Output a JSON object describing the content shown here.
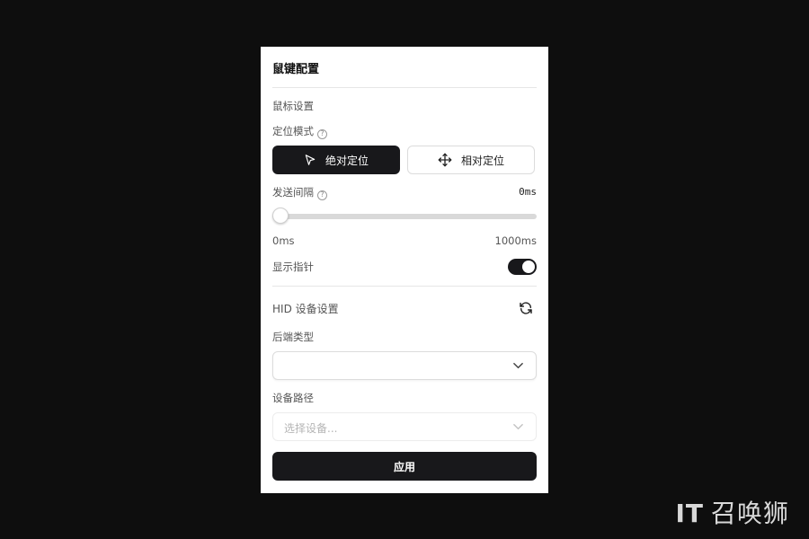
{
  "panel": {
    "title": "鼠键配置",
    "mouse_section": "鼠标设置",
    "position_mode": {
      "label": "定位模式",
      "absolute_label": "绝对定位",
      "relative_label": "相对定位",
      "selected": "absolute"
    },
    "send_interval": {
      "label": "发送间隔",
      "value": "0ms",
      "min_label": "0ms",
      "max_label": "1000ms",
      "value_ms": 0,
      "max_ms": 1000
    },
    "show_pointer": {
      "label": "显示指针",
      "enabled": true
    },
    "hid_section": "HID 设备设置",
    "backend_type": {
      "label": "后端类型",
      "value": ""
    },
    "device_path": {
      "label": "设备路径",
      "placeholder": "选择设备..."
    },
    "apply_label": "应用",
    "help_glyph": "?"
  },
  "watermark": {
    "it": "IT",
    "text": "召唤狮"
  },
  "icons": {
    "absolute": "cursor-arrow-icon",
    "relative": "move-arrows-icon",
    "refresh": "refresh-icon",
    "chevron": "chevron-down-icon",
    "help": "help-circle-icon"
  },
  "colors": {
    "accent": "#18181b",
    "background": "#0e0e0e",
    "panel": "#ffffff"
  }
}
